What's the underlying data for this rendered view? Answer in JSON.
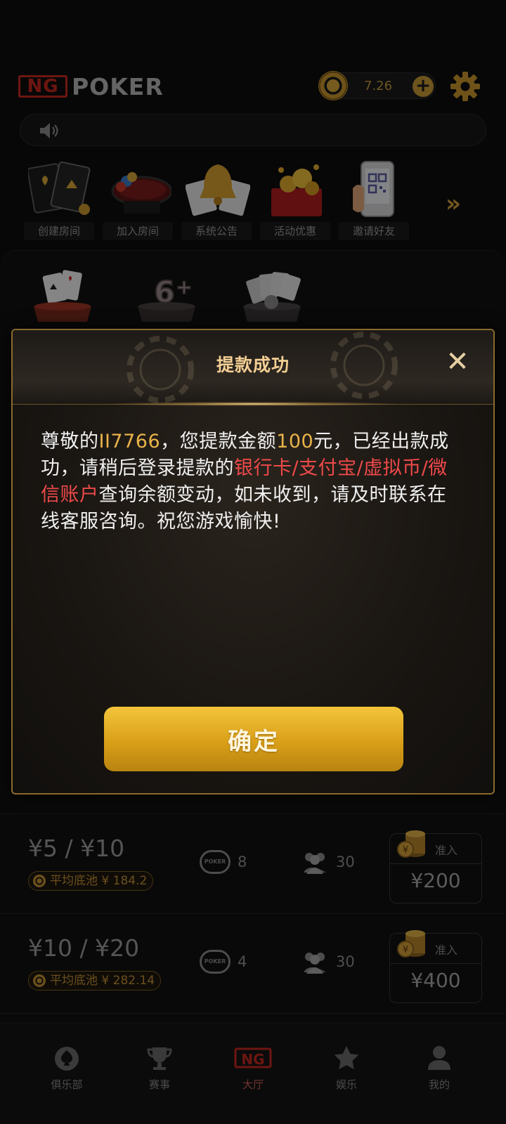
{
  "header": {
    "logo_ng": "NG",
    "logo_poker": "POKER",
    "balance": "7.26",
    "plus_symbol": "+"
  },
  "shortcuts": [
    {
      "label": "创建房间",
      "icon": "cards-icon"
    },
    {
      "label": "加入房间",
      "icon": "table-icon"
    },
    {
      "label": "系统公告",
      "icon": "bell-icon"
    },
    {
      "label": "活动优惠",
      "icon": "gift-icon"
    },
    {
      "label": "邀请好友",
      "icon": "qr-phone-icon"
    }
  ],
  "more_arrow": "»",
  "table_rows": [
    {
      "blinds": "¥5 / ¥10",
      "pot": "平均底池 ¥ 184.2",
      "tables_icon_text": "POKER",
      "tables": "8",
      "players": "30",
      "buyin_label": "准入",
      "buyin": "¥200"
    },
    {
      "blinds": "¥10 / ¥20",
      "pot": "平均底池 ¥ 282.14",
      "tables_icon_text": "POKER",
      "tables": "4",
      "players": "30",
      "buyin_label": "准入",
      "buyin": "¥400"
    }
  ],
  "modal": {
    "title": "提款成功",
    "close_symbol": "✕",
    "body": {
      "p1": "尊敬的",
      "username": "II7766",
      "p2": "，您提款金额",
      "amount": "100",
      "p3": "元，已经出款成功，请稍后登录提款的",
      "accounts": "银行卡/支付宝/虚拟币/微信账户",
      "p4": "查询余额变动，如未收到，请及时联系在线客服咨询。祝您游戏愉快!"
    },
    "confirm": "确定"
  },
  "bottom_nav": [
    {
      "label": "俱乐部",
      "icon": "spade-icon"
    },
    {
      "label": "赛事",
      "icon": "trophy-icon"
    },
    {
      "label": "大厅",
      "icon": "ng-logo-icon",
      "icon_text": "NG",
      "active": true
    },
    {
      "label": "娱乐",
      "icon": "star-icon"
    },
    {
      "label": "我的",
      "icon": "user-icon"
    }
  ],
  "colors": {
    "accent_gold": "#d99f18",
    "highlight_gold": "#e9b34a",
    "highlight_red": "#ef4a4a",
    "brand_red": "#c7291f"
  }
}
